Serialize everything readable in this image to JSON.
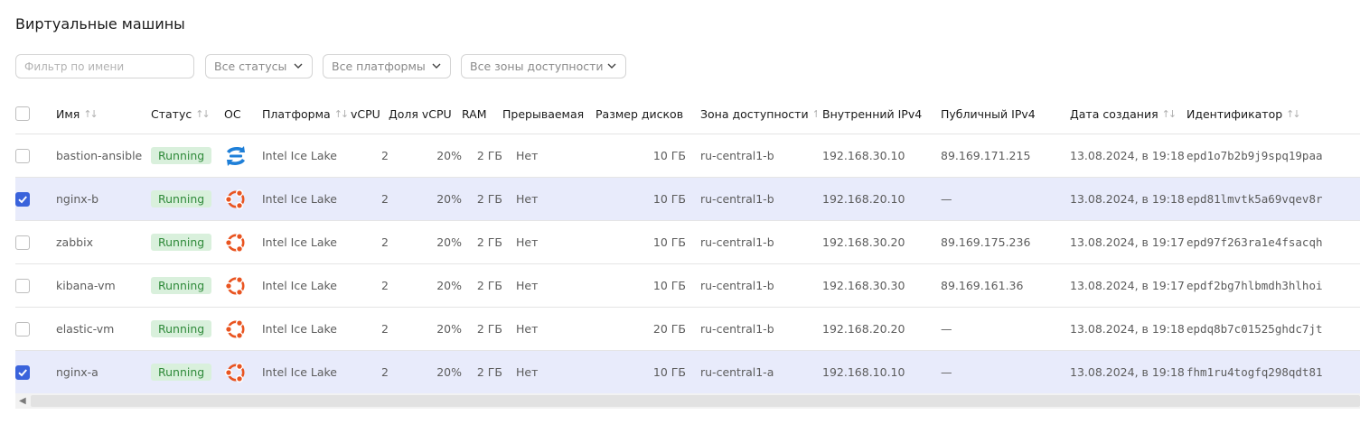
{
  "page": {
    "title": "Виртуальные машины"
  },
  "filters": {
    "name_placeholder": "Фильтр по имени",
    "status_select": "Все статусы",
    "platform_select": "Все платформы",
    "zone_select": "Все зоны доступности"
  },
  "columns": {
    "name": "Имя",
    "status": "Статус",
    "os": "ОС",
    "platform": "Платформа",
    "vcpu": "vCPU",
    "vcpu_share": "Доля vCPU",
    "ram": "RAM",
    "preemptible": "Прерываемая",
    "disk_size": "Размер дисков",
    "zone": "Зона доступности",
    "internal_ip": "Внутренний IPv4",
    "public_ip": "Публичный IPv4",
    "created": "Дата создания",
    "id": "Идентификатор"
  },
  "rows": [
    {
      "selected": false,
      "name": "bastion-ansible",
      "status": "Running",
      "os": "almalinux-icon",
      "platform": "Intel Ice Lake",
      "vcpu": "2",
      "vcpu_share": "20%",
      "ram": "2 ГБ",
      "preemptible": "Нет",
      "disk_size": "10 ГБ",
      "zone": "ru-central1-b",
      "internal_ip": "192.168.30.10",
      "public_ip": "89.169.171.215",
      "created": "13.08.2024, в 19:18",
      "id": "epd1o7b2b9j9spq19paa"
    },
    {
      "selected": true,
      "name": "nginx-b",
      "status": "Running",
      "os": "ubuntu-icon",
      "platform": "Intel Ice Lake",
      "vcpu": "2",
      "vcpu_share": "20%",
      "ram": "2 ГБ",
      "preemptible": "Нет",
      "disk_size": "10 ГБ",
      "zone": "ru-central1-b",
      "internal_ip": "192.168.20.10",
      "public_ip": "—",
      "created": "13.08.2024, в 19:18",
      "id": "epd81lmvtk5a69vqev8r"
    },
    {
      "selected": false,
      "name": "zabbix",
      "status": "Running",
      "os": "ubuntu-icon",
      "platform": "Intel Ice Lake",
      "vcpu": "2",
      "vcpu_share": "20%",
      "ram": "2 ГБ",
      "preemptible": "Нет",
      "disk_size": "10 ГБ",
      "zone": "ru-central1-b",
      "internal_ip": "192.168.30.20",
      "public_ip": "89.169.175.236",
      "created": "13.08.2024, в 19:17",
      "id": "epd97f263ra1e4fsacqh"
    },
    {
      "selected": false,
      "name": "kibana-vm",
      "status": "Running",
      "os": "ubuntu-icon",
      "platform": "Intel Ice Lake",
      "vcpu": "2",
      "vcpu_share": "20%",
      "ram": "2 ГБ",
      "preemptible": "Нет",
      "disk_size": "10 ГБ",
      "zone": "ru-central1-b",
      "internal_ip": "192.168.30.30",
      "public_ip": "89.169.161.36",
      "created": "13.08.2024, в 19:17",
      "id": "epdf2bg7hlbmdh3hlhoi"
    },
    {
      "selected": false,
      "name": "elastic-vm",
      "status": "Running",
      "os": "ubuntu-icon",
      "platform": "Intel Ice Lake",
      "vcpu": "2",
      "vcpu_share": "20%",
      "ram": "2 ГБ",
      "preemptible": "Нет",
      "disk_size": "20 ГБ",
      "zone": "ru-central1-b",
      "internal_ip": "192.168.20.20",
      "public_ip": "—",
      "created": "13.08.2024, в 19:18",
      "id": "epdq8b7c01525ghdc7jt"
    },
    {
      "selected": true,
      "name": "nginx-a",
      "status": "Running",
      "os": "ubuntu-icon",
      "platform": "Intel Ice Lake",
      "vcpu": "2",
      "vcpu_share": "20%",
      "ram": "2 ГБ",
      "preemptible": "Нет",
      "disk_size": "10 ГБ",
      "zone": "ru-central1-a",
      "internal_ip": "192.168.10.10",
      "public_ip": "—",
      "created": "13.08.2024, в 19:18",
      "id": "fhm1ru4togfq298qdt81"
    }
  ],
  "colors": {
    "accent": "#3a63db",
    "selected_row": "#e8ebfb",
    "status_bg": "#d9f0dc",
    "status_text": "#2f8a3a",
    "ubuntu": "#e95420",
    "almalinux": "#1e7fd8"
  }
}
